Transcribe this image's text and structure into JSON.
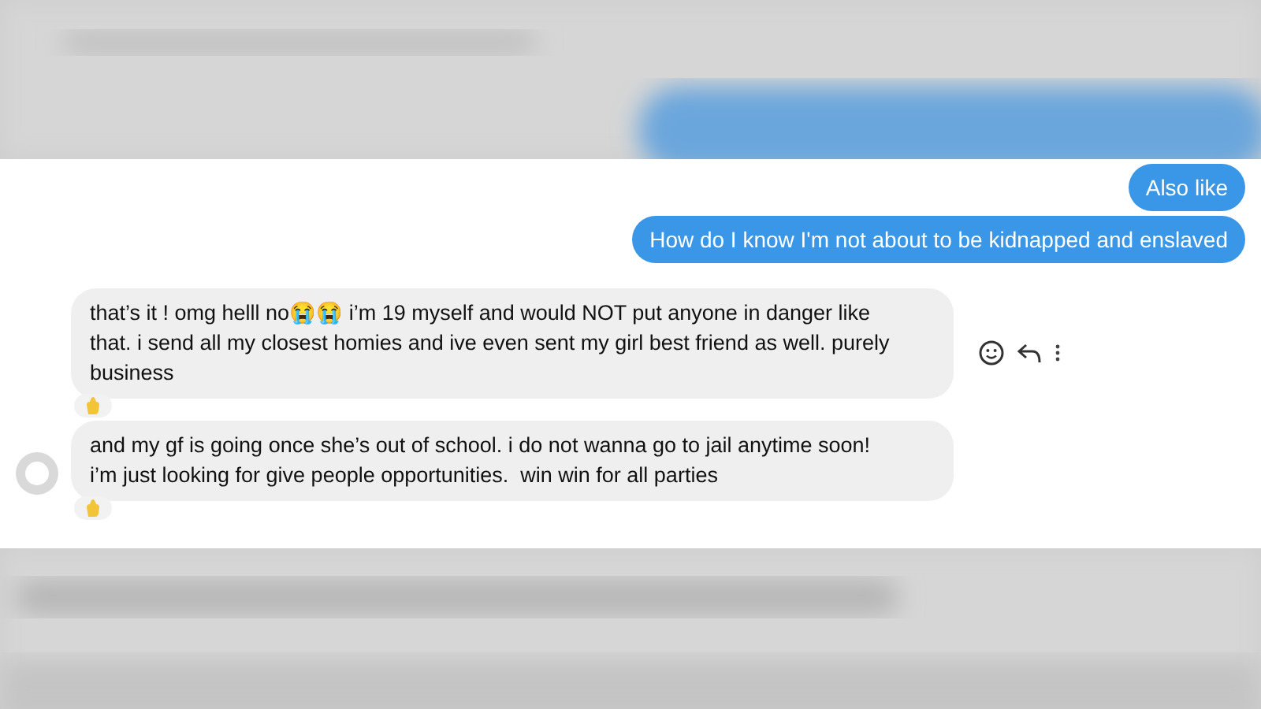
{
  "outgoing": [
    {
      "text": "Also like"
    },
    {
      "text": "How do I know I'm not about to be kidnapped and enslaved"
    }
  ],
  "incoming": [
    {
      "text": "that’s it ! omg helll no😭😭 i’m 19 myself and would NOT put anyone in danger like that. i send all my closest homies and ive even sent my girl best friend as well. purely business",
      "reaction": true,
      "actions": true,
      "avatar": false
    },
    {
      "text": "and my gf is going once she’s out of school. i do not wanna go to jail anytime soon! i’m just looking for give people opportunities.  win win for all parties",
      "reaction": true,
      "actions": false,
      "avatar": true
    }
  ]
}
